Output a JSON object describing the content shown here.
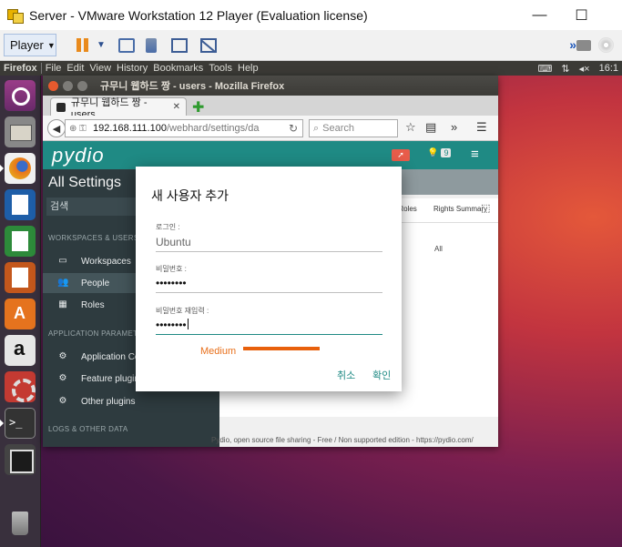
{
  "vmware": {
    "title": "Server - VMware Workstation 12 Player (Evaluation license)",
    "player_label": "Player",
    "minimize": "—",
    "maximize": "☐",
    "close": "✕"
  },
  "ubuntu_panel": {
    "app_name": "Firefox",
    "menus": [
      "File",
      "Edit",
      "View",
      "History",
      "Bookmarks",
      "Tools",
      "Help"
    ],
    "clock": "16:1",
    "icons": [
      "keyboard-icon",
      "network-icon",
      "volume-icon"
    ]
  },
  "launcher": {
    "items": [
      "ubuntu-dash",
      "files",
      "firefox",
      "libreoffice-writer",
      "libreoffice-calc",
      "libreoffice-impress",
      "software-center",
      "amazon",
      "system-settings",
      "terminal",
      "disk",
      "trash"
    ]
  },
  "firefox": {
    "window_title": "규무니 웹하드 짱 - users - Mozilla Firefox",
    "tab_label": "규무니 웹하드 짱 - users",
    "url_host": "192.168.111.100",
    "url_path": "/webhard/settings/da",
    "search_placeholder": "Search"
  },
  "pydio": {
    "logo": "pydio",
    "notification_count": "9",
    "sidebar": {
      "title": "All Settings",
      "search_placeholder": "검색",
      "section_workspaces": "WORKSPACES & USERS",
      "workspaces": "Workspaces",
      "people": "People",
      "roles": "Roles",
      "section_parameters": "APPLICATION PARAMETERS",
      "application_core": "Application Core",
      "feature_plugins": "Feature plugins",
      "other_plugins": "Other plugins",
      "section_logs": "LOGS & OTHER DATA"
    },
    "main": {
      "col_roles": "er Roles",
      "col_rights": "Rights Summary",
      "cell_all": "All"
    },
    "footer": "Pydio, open source file sharing - Free / Non supported edition - https://pydio.com/"
  },
  "dialog": {
    "title": "새 사용자 추가",
    "login_label": "로그인 :",
    "login_value": "Ubuntu",
    "password_label": "비밀번호 :",
    "password_value": "••••••••",
    "confirm_label": "비밀번호 재입력 :",
    "confirm_value": "••••••••",
    "strength_label": "Medium",
    "strength_fraction": 0.55,
    "strength_color": "#e8600c",
    "cancel": "취소",
    "ok": "확인"
  },
  "colors": {
    "pydio_teal": "#1f8a84",
    "sidebar_bg": "#2e3b3f",
    "ubuntu_panel": "#3b3a36"
  }
}
